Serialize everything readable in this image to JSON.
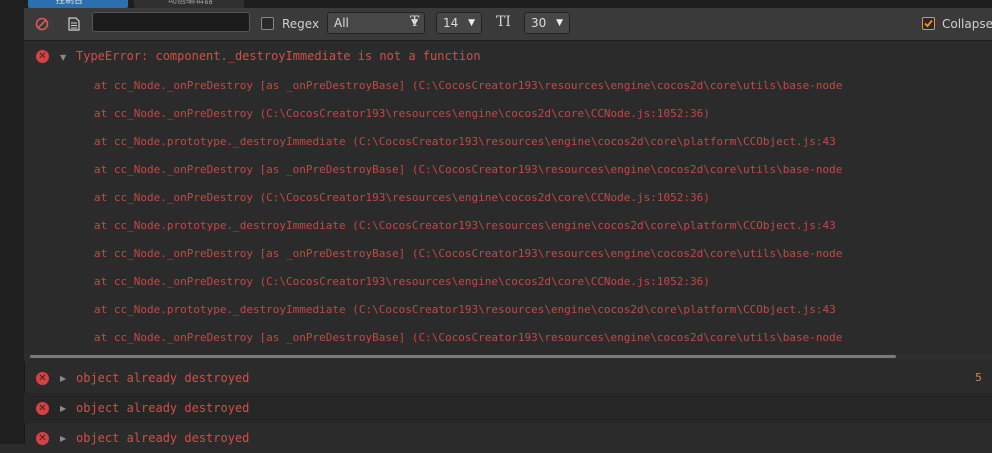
{
  "tabs": [
    {
      "label": "控制台"
    },
    {
      "label": "动画编辑器"
    }
  ],
  "toolbar": {
    "clear_icon": "no-entry-icon",
    "open_log_icon": "document-icon",
    "search_value": "",
    "regex_label": "Regex",
    "level_value": "All",
    "font_size_value": "14",
    "line_height_value": "30",
    "collapse_label": "Collapse",
    "collapse_checked": true
  },
  "log": {
    "expanded": {
      "message": "TypeError: component._destroyImmediate is not a function",
      "stack": [
        "at cc_Node._onPreDestroy [as _onPreDestroyBase] (C:\\CocosCreator193\\resources\\engine\\cocos2d\\core\\utils\\base-node",
        "at cc_Node._onPreDestroy (C:\\CocosCreator193\\resources\\engine\\cocos2d\\core\\CCNode.js:1052:36)",
        "at cc_Node.prototype._destroyImmediate (C:\\CocosCreator193\\resources\\engine\\cocos2d\\core\\platform\\CCObject.js:43",
        "at cc_Node._onPreDestroy [as _onPreDestroyBase] (C:\\CocosCreator193\\resources\\engine\\cocos2d\\core\\utils\\base-node",
        "at cc_Node._onPreDestroy (C:\\CocosCreator193\\resources\\engine\\cocos2d\\core\\CCNode.js:1052:36)",
        "at cc_Node.prototype._destroyImmediate (C:\\CocosCreator193\\resources\\engine\\cocos2d\\core\\platform\\CCObject.js:43",
        "at cc_Node._onPreDestroy [as _onPreDestroyBase] (C:\\CocosCreator193\\resources\\engine\\cocos2d\\core\\utils\\base-node",
        "at cc_Node._onPreDestroy (C:\\CocosCreator193\\resources\\engine\\cocos2d\\core\\CCNode.js:1052:36)",
        "at cc_Node.prototype._destroyImmediate (C:\\CocosCreator193\\resources\\engine\\cocos2d\\core\\platform\\CCObject.js:43",
        "at cc_Node._onPreDestroy [as _onPreDestroyBase] (C:\\CocosCreator193\\resources\\engine\\cocos2d\\core\\utils\\base-node"
      ]
    },
    "entries": [
      {
        "message": "object already destroyed",
        "count": "5"
      },
      {
        "message": "object already destroyed",
        "count": ""
      },
      {
        "message": "object already destroyed",
        "count": ""
      }
    ]
  },
  "colors": {
    "error": "#d94a4a",
    "toolbar_bg": "#3a3a3a",
    "panel_bg": "#2b2b2b",
    "accent_tab": "#2a6fb0"
  }
}
